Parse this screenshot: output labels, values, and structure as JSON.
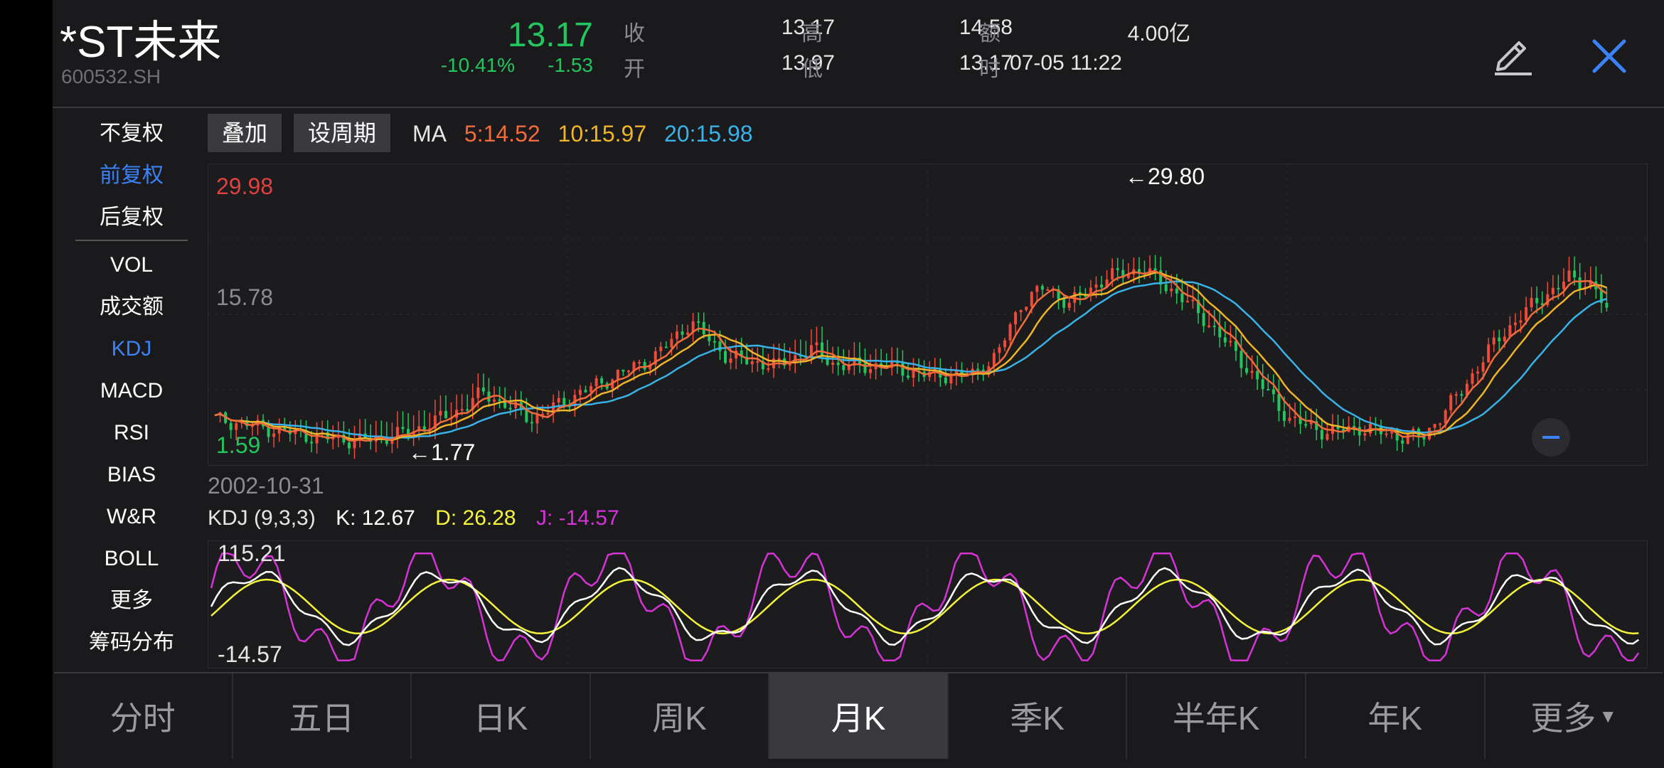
{
  "header": {
    "name": "*ST未来",
    "code": "600532.SH",
    "price": "13.17",
    "change_pct": "-10.41%",
    "change_abs": "-1.53",
    "quote": [
      {
        "label": "收",
        "value": "13.17"
      },
      {
        "label": "高",
        "value": "14.58"
      },
      {
        "label": "额",
        "value": "4.00亿"
      },
      {
        "label": "开",
        "value": "13.97"
      },
      {
        "label": "低",
        "value": "13.17"
      },
      {
        "label": "时",
        "value": "07-05 11:22"
      }
    ]
  },
  "side_menu": {
    "fq": [
      {
        "label": "不复权",
        "active": false
      },
      {
        "label": "前复权",
        "active": true
      },
      {
        "label": "后复权",
        "active": false
      }
    ],
    "indicators": [
      {
        "label": "VOL",
        "active": false
      },
      {
        "label": "成交额",
        "active": false
      },
      {
        "label": "KDJ",
        "active": true
      },
      {
        "label": "MACD",
        "active": false
      },
      {
        "label": "RSI",
        "active": false
      },
      {
        "label": "BIAS",
        "active": false
      },
      {
        "label": "W&R",
        "active": false
      },
      {
        "label": "BOLL",
        "active": false
      },
      {
        "label": "更多",
        "active": false
      },
      {
        "label": "筹码分布",
        "active": false
      }
    ]
  },
  "toolbar": {
    "overlay": "叠加",
    "set_period": "设周期"
  },
  "ma": {
    "label": "MA",
    "items": [
      {
        "text": "5:14.52",
        "color": "#f26b3a"
      },
      {
        "text": "10:15.97",
        "color": "#f0b429"
      },
      {
        "text": "20:15.98",
        "color": "#38b2e8"
      }
    ]
  },
  "price_chart": {
    "axis_top": "29.98",
    "axis_mid": "15.78",
    "axis_bottom": "1.59",
    "high_marker": "29.80",
    "low_marker": "1.77",
    "date": "2002-10-31",
    "zoom_icon": "minus-icon"
  },
  "kdj": {
    "title": "KDJ (9,3,3)",
    "k": "K: 12.67",
    "d": "D: 26.28",
    "j": "J: -14.57",
    "k_color": "#ffffff",
    "d_color": "#f5f53a",
    "j_color": "#d633d6",
    "axis_top": "115.21",
    "axis_bottom": "-14.57"
  },
  "tabs": [
    {
      "label": "分时",
      "active": false
    },
    {
      "label": "五日",
      "active": false
    },
    {
      "label": "日K",
      "active": false
    },
    {
      "label": "周K",
      "active": false
    },
    {
      "label": "月K",
      "active": true
    },
    {
      "label": "季K",
      "active": false
    },
    {
      "label": "半年K",
      "active": false
    },
    {
      "label": "年K",
      "active": false
    },
    {
      "label": "更多",
      "active": false
    }
  ],
  "colors": {
    "up": "#f04a3a",
    "down": "#22c55e",
    "accent": "#3b82f6",
    "close": "#3b82f6"
  }
}
